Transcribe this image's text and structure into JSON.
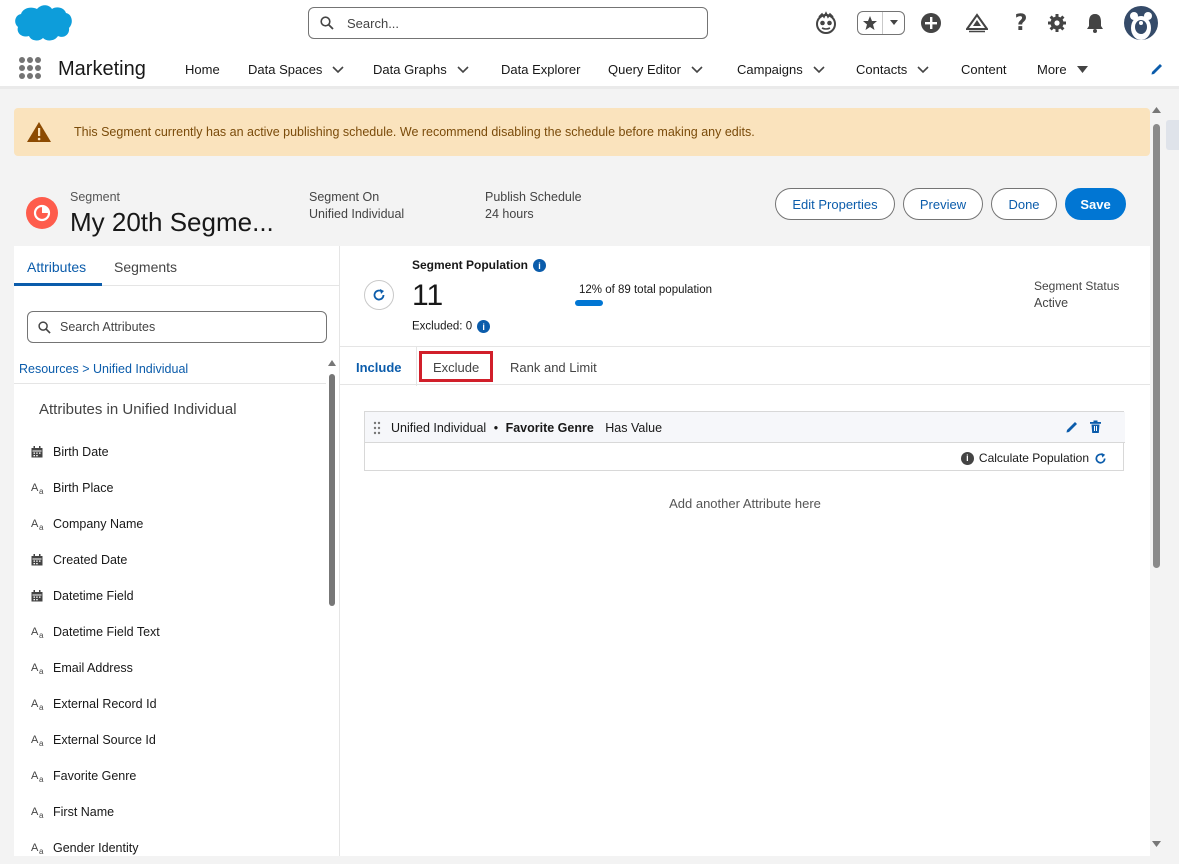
{
  "header": {
    "search_placeholder": "Search...",
    "icons": [
      "salesforce-cloud-logo",
      "search-icon",
      "einstein-icon",
      "favorites-star-icon",
      "chevron-down-icon",
      "add-icon",
      "trailhead-icon",
      "help-icon",
      "gear-icon",
      "bell-icon",
      "avatar"
    ]
  },
  "nav": {
    "app_name": "Marketing",
    "items": [
      {
        "label": "Home",
        "has_menu": false
      },
      {
        "label": "Data Spaces",
        "has_menu": true
      },
      {
        "label": "Data Graphs",
        "has_menu": true
      },
      {
        "label": "Data Explorer",
        "has_menu": false
      },
      {
        "label": "Query Editor",
        "has_menu": true
      },
      {
        "label": "Campaigns",
        "has_menu": true
      },
      {
        "label": "Contacts",
        "has_menu": true
      },
      {
        "label": "Content",
        "has_menu": false
      },
      {
        "label": "More",
        "has_menu": true
      }
    ]
  },
  "banner": {
    "message": "This Segment currently has an active publishing schedule. We recommend disabling the schedule before making any edits.",
    "color": "#fae3bd"
  },
  "record": {
    "type_label": "Segment",
    "name": "My 20th Segme...",
    "segment_on_label": "Segment On",
    "segment_on_value": "Unified Individual",
    "publish_label": "Publish Schedule",
    "publish_value": "24 hours",
    "buttons": {
      "edit_properties": "Edit Properties",
      "preview": "Preview",
      "done": "Done",
      "save": "Save"
    }
  },
  "left_panel": {
    "tabs": [
      "Attributes",
      "Segments"
    ],
    "search_placeholder": "Search Attributes",
    "breadcrumb": "Resources > Unified Individual",
    "heading": "Attributes in Unified Individual",
    "attributes": [
      {
        "label": "Birth Date",
        "type": "date"
      },
      {
        "label": "Birth Place",
        "type": "text"
      },
      {
        "label": "Company Name",
        "type": "text"
      },
      {
        "label": "Created Date",
        "type": "date"
      },
      {
        "label": "Datetime Field",
        "type": "date"
      },
      {
        "label": "Datetime Field Text",
        "type": "text"
      },
      {
        "label": "Email Address",
        "type": "text"
      },
      {
        "label": "External Record Id",
        "type": "text"
      },
      {
        "label": "External Source Id",
        "type": "text"
      },
      {
        "label": "Favorite Genre",
        "type": "text"
      },
      {
        "label": "First Name",
        "type": "text"
      },
      {
        "label": "Gender Identity",
        "type": "text"
      }
    ]
  },
  "population": {
    "label": "Segment Population",
    "value": "11",
    "excluded": "Excluded: 0",
    "percent_text": "12% of 89 total population",
    "percent": 0.12,
    "status_label": "Segment Status",
    "status_value": "Active"
  },
  "rule_tabs": [
    "Include",
    "Exclude",
    "Rank and Limit"
  ],
  "rule": {
    "object": "Unified Individual",
    "separator": "•",
    "attribute": "Favorite Genre",
    "operator": "Has Value",
    "calculate": "Calculate Population"
  },
  "add_attribute": "Add another Attribute here",
  "colors": {
    "brand_blue": "#0176d3",
    "link_blue": "#0b5cab",
    "segment_icon": "#fe5c4c",
    "highlight_red": "#d11f2a"
  }
}
